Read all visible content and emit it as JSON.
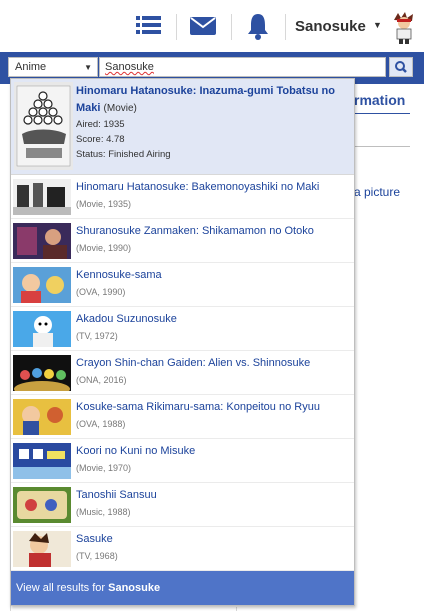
{
  "header": {
    "icons": [
      "list-icon",
      "mail-icon",
      "bell-icon"
    ],
    "username": "Sanosuke",
    "accent": "#2e51a2"
  },
  "search": {
    "type_label": "Anime",
    "query": "Sanosuke"
  },
  "background_page": {
    "heading": "rmation",
    "link": "a picture"
  },
  "results": {
    "featured": {
      "title": "Hinomaru Hatanosuke: Inazuma-gumi Tobatsu no Maki",
      "type": "(Movie)",
      "aired": "Aired: 1935",
      "score": "Score: 4.78",
      "status": "Status: Finished Airing"
    },
    "items": [
      {
        "title": "Hinomaru Hatanosuke: Bakemonoyashiki no Maki",
        "sub": "(Movie, 1935)"
      },
      {
        "title": "Shuranosuke Zanmaken: Shikamamon no Otoko",
        "sub": "(Movie, 1990)"
      },
      {
        "title": "Kennosuke-sama",
        "sub": "(OVA, 1990)"
      },
      {
        "title": "Akadou Suzunosuke",
        "sub": "(TV, 1972)"
      },
      {
        "title": "Crayon Shin-chan Gaiden: Alien vs. Shinnosuke",
        "sub": "(ONA, 2016)"
      },
      {
        "title": "Kosuke-sama Rikimaru-sama: Konpeitou no Ryuu",
        "sub": "(OVA, 1988)"
      },
      {
        "title": "Koori no Kuni no Misuke",
        "sub": "(Movie, 1970)"
      },
      {
        "title": "Tanoshii Sansuu",
        "sub": "(Music, 1988)"
      },
      {
        "title": "Sasuke",
        "sub": "(TV, 1968)"
      }
    ],
    "view_all_prefix": "View all results for ",
    "view_all_query": "Sanosuke"
  }
}
